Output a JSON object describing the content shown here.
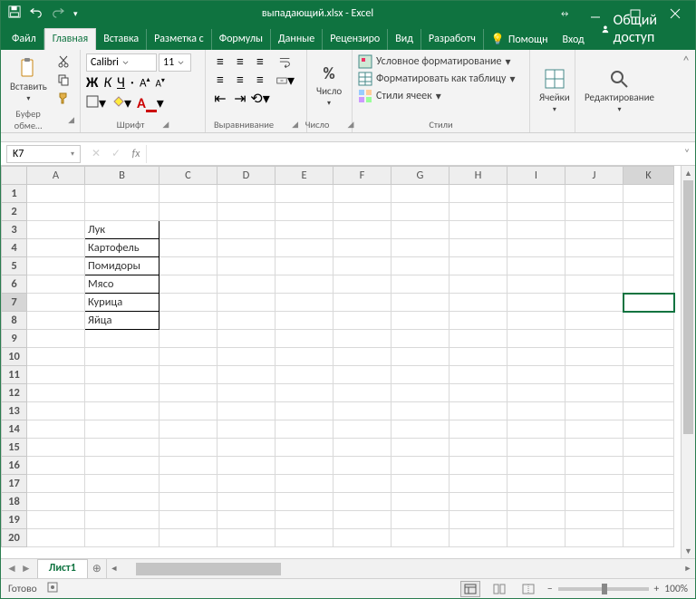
{
  "titlebar": {
    "title": "выпадающий.xlsx - Excel"
  },
  "tabs": {
    "file": "Файл",
    "home": "Главная",
    "insert": "Вставка",
    "layout": "Разметка с",
    "formulas": "Формулы",
    "data": "Данные",
    "review": "Рецензиро",
    "view": "Вид",
    "developer": "Разработч",
    "help": "Помощн",
    "login": "Вход",
    "share": "Общий доступ"
  },
  "ribbon": {
    "clipboard": {
      "paste": "Вставить",
      "label": "Буфер обме…"
    },
    "font": {
      "name": "Calibri",
      "size": "11",
      "bold": "Ж",
      "italic": "К",
      "underline": "Ч",
      "label": "Шрифт"
    },
    "align": {
      "label": "Выравнивание"
    },
    "number": {
      "btn": "Число",
      "sym": "%",
      "label": "Число"
    },
    "styles": {
      "cond": "Условное форматирование",
      "tbl": "Форматировать как таблицу",
      "cell": "Стили ячеек",
      "label": "Стили"
    },
    "cells": {
      "btn": "Ячейки"
    },
    "editing": {
      "btn": "Редактирование"
    }
  },
  "fx": {
    "cell_ref": "K7",
    "fx": "fx",
    "value": ""
  },
  "columns": [
    "A",
    "B",
    "C",
    "D",
    "E",
    "F",
    "G",
    "H",
    "I",
    "J",
    "K"
  ],
  "rows": 20,
  "selected": {
    "row": 7,
    "col": "K"
  },
  "data_cells": {
    "B3": "Лук",
    "B4": "Картофель",
    "B5": "Помидоры",
    "B6": "Мясо",
    "B7": "Курица",
    "B8": "Яйца"
  },
  "bordered_range": {
    "col": "B",
    "r1": 3,
    "r2": 8
  },
  "sheet": {
    "name": "Лист1"
  },
  "status": {
    "ready": "Готово",
    "zoom": "100%"
  }
}
